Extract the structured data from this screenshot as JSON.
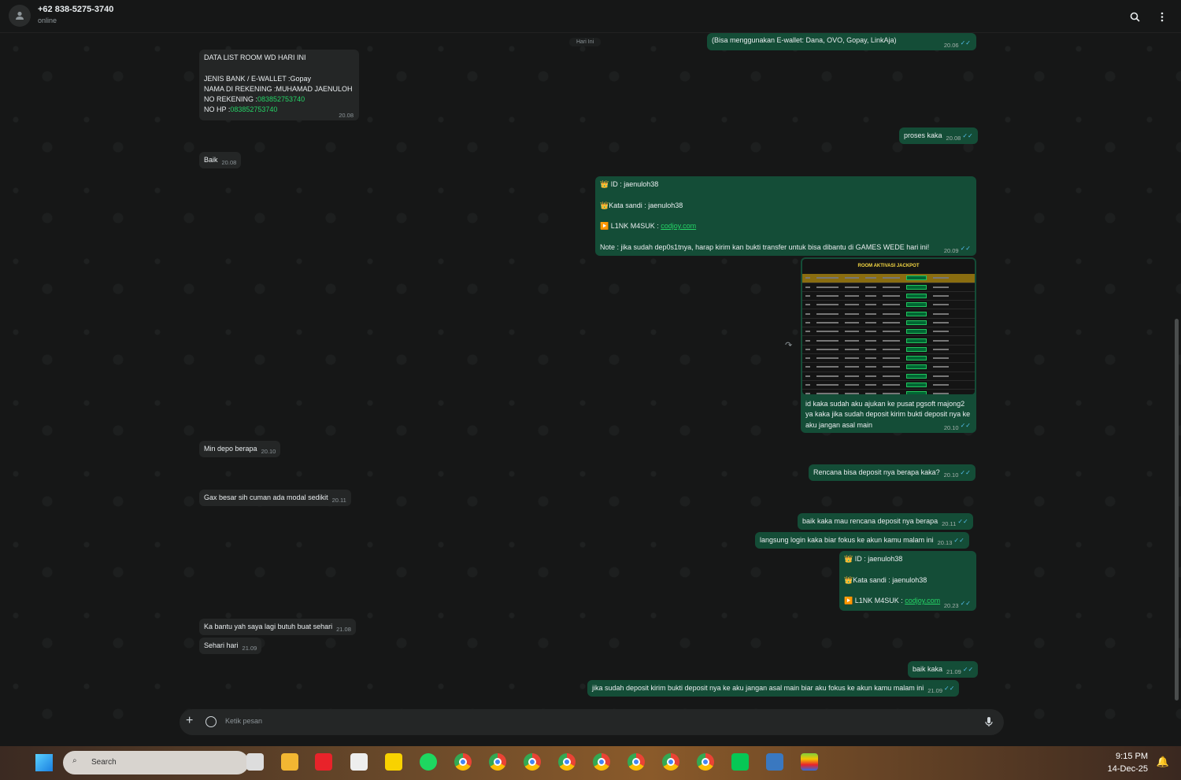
{
  "header": {
    "contact_name": "+62 838-5275-3740",
    "status": "online"
  },
  "date_chip": "Hari Ini",
  "messages": [
    {
      "dir": "out",
      "text": "(Bisa menggunakan E-wallet: Dana, OVO, Gopay, LinkAja)",
      "time": "20.06"
    },
    {
      "dir": "in",
      "title": "DATA LIST ROOM WD HARI INI",
      "bank_label": "JENIS BANK / E-WALLET :",
      "bank": "Gopay",
      "name_label": "NAMA DI REKENING :",
      "name": "MUHAMAD JAENULOH",
      "rek_label": "NO REKENING :",
      "rek": "083852753740",
      "hp_label": "NO HP :",
      "hp": "083852753740",
      "time": "20.08"
    },
    {
      "dir": "out",
      "text": "proses kaka",
      "time": "20.08"
    },
    {
      "dir": "in",
      "text": "Baik",
      "time": "20.08"
    },
    {
      "dir": "out",
      "id_line": "ID :  jaenuloh38",
      "pw_line": "Kata sandi : jaenuloh38",
      "link_label": "L1NK M4SUK : ",
      "link": "codjoy.com",
      "note": "Note : jika sudah dep0s1tnya, harap kirim kan bukti transfer untuk bisa dibantu di GAMES WEDE hari ini!",
      "time": "20.09"
    },
    {
      "dir": "out",
      "image_title": "ROOM AKTIVASI JACKPOT",
      "text": "id kaka sudah aku ajukan ke pusat pgsoft majong2 ya kaka jika sudah deposit kirim bukti deposit nya ke aku jangan asal main",
      "time": "20.10"
    },
    {
      "dir": "in",
      "text": "Min depo berapa",
      "time": "20.10"
    },
    {
      "dir": "out",
      "text": "Rencana bisa deposit nya berapa kaka?",
      "time": "20.10"
    },
    {
      "dir": "in",
      "text": "Gax besar sih cuman ada modal sedikit",
      "time": "20.11"
    },
    {
      "dir": "out",
      "text": "baik kaka mau rencana deposit nya berapa",
      "time": "20.11"
    },
    {
      "dir": "out",
      "text": "langsung login kaka biar fokus ke akun kamu malam ini",
      "time": "20.13"
    },
    {
      "dir": "out",
      "id_line": "ID :  jaenuloh38",
      "pw_line": "Kata sandi : jaenuloh38",
      "link_label": "L1NK M4SUK : ",
      "link": "codjoy.com",
      "time": "20.23"
    },
    {
      "dir": "in",
      "text": "Ka bantu yah saya lagi butuh buat sehari",
      "time": "21.08"
    },
    {
      "dir": "in",
      "text": "Sehari hari",
      "time": "21.09"
    },
    {
      "dir": "out",
      "text": "baik kaka",
      "time": "21.09"
    },
    {
      "dir": "out",
      "text": "jika sudah deposit kirim bukti deposit nya ke aku jangan asal main biar aku fokus ke akun kamu malam ini",
      "time": "21.09"
    }
  ],
  "composer": {
    "placeholder": "Ketik pesan"
  },
  "taskbar": {
    "search": "Search",
    "time": "9:15 PM",
    "date": "14-Dec-25"
  },
  "colors": {
    "incoming": "#242626",
    "outgoing": "#144d37",
    "accent": "#25d366"
  }
}
